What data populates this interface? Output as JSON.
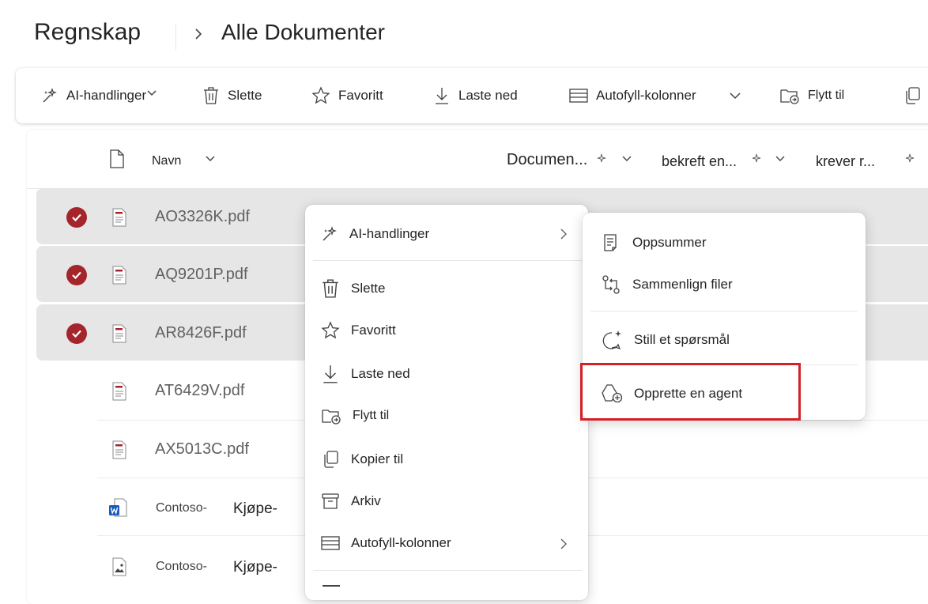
{
  "breadcrumb": {
    "root": "Regnskap",
    "current": "Alle Dokumenter"
  },
  "toolbar": {
    "ai_actions": "AI-handlinger",
    "delete": "Slette",
    "favorite": "Favoritt",
    "download": "Laste ned",
    "autofill": "Autofyll-kolonner",
    "move_to": "Flytt til"
  },
  "columns": {
    "name": "Navn",
    "document": "Documen...",
    "confirm": "bekreft en...",
    "requires": "krever r..."
  },
  "files": [
    {
      "name": "AO3326K.pdf",
      "selected": true
    },
    {
      "name": "AQ9201P.pdf",
      "selected": true
    },
    {
      "name": "AR8426F.pdf",
      "selected": true
    },
    {
      "name": "AT6429V.pdf",
      "selected": false
    },
    {
      "name": "AX5013C.pdf",
      "selected": false
    },
    {
      "name_a": "Contoso-",
      "name_b": "Kjøpe-",
      "type": "word"
    },
    {
      "name_a": "Contoso-",
      "name_b": "Kjøpe-",
      "type": "image"
    }
  ],
  "context_menu": {
    "ai_actions": "AI-handlinger",
    "delete": "Slette",
    "favorite": "Favoritt",
    "download": "Laste ned",
    "move_to": "Flytt til",
    "copy_to": "Kopier til",
    "archive": "Arkiv",
    "autofill": "Autofyll-kolonner"
  },
  "submenu": {
    "summarize": "Oppsummer",
    "compare": "Sammenlign filer",
    "ask": "Still et spørsmål",
    "create_agent": "Opprette en agent"
  },
  "colors": {
    "check": "#a4262c",
    "highlight": "#d42027",
    "pdf": "#a4262c",
    "word": "#185abd"
  }
}
